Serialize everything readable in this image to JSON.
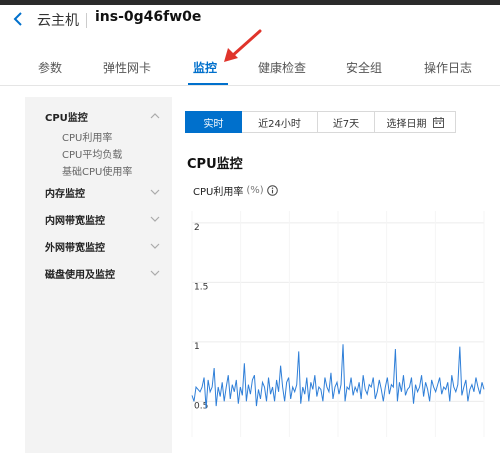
{
  "header": {
    "host_label": "云主机",
    "instance_id": "ins-0g46fw0e"
  },
  "tabs": [
    {
      "label": "参数",
      "active": false
    },
    {
      "label": "弹性网卡",
      "active": false
    },
    {
      "label": "监控",
      "active": true
    },
    {
      "label": "健康检查",
      "active": false
    },
    {
      "label": "安全组",
      "active": false
    },
    {
      "label": "操作日志",
      "active": false
    }
  ],
  "sidebar": {
    "groups": [
      {
        "label": "CPU监控",
        "expanded": true,
        "items": [
          "CPU利用率",
          "CPU平均负载",
          "基础CPU使用率"
        ]
      },
      {
        "label": "内存监控",
        "expanded": false
      },
      {
        "label": "内网带宽监控",
        "expanded": false
      },
      {
        "label": "外网带宽监控",
        "expanded": false
      },
      {
        "label": "磁盘使用及监控",
        "expanded": false
      }
    ]
  },
  "time_range": {
    "options": [
      "实时",
      "近24小时",
      "近7天",
      "选择日期"
    ],
    "selected": "实时"
  },
  "section_title": "CPU监控",
  "chart_title": "CPU利用率",
  "chart_unit": "(%)",
  "colors": {
    "accent": "#0070cc",
    "line": "#2f7fd8",
    "annotation_arrow": "#e0342b"
  },
  "chart_data": {
    "type": "line",
    "title": "CPU利用率",
    "ylabel": "(%)",
    "xlabel": "",
    "ylim": [
      0.2,
      2.1
    ],
    "y_ticks": [
      "2",
      "1.5",
      "1",
      "0.5"
    ],
    "grid": true,
    "series": [
      {
        "values": [
          0.55,
          0.5,
          0.62,
          0.6,
          0.58,
          0.62,
          0.7,
          0.44,
          0.68,
          0.58,
          0.62,
          0.78,
          0.46,
          0.62,
          0.54,
          0.66,
          0.5,
          0.62,
          0.72,
          0.52,
          0.64,
          0.58,
          0.68,
          0.48,
          0.62,
          0.55,
          0.82,
          0.5,
          0.64,
          0.56,
          0.68,
          0.72,
          0.46,
          0.6,
          0.52,
          0.66,
          0.62,
          0.5,
          0.7,
          0.56,
          0.62,
          0.5,
          0.68,
          0.58,
          0.8,
          0.62,
          0.5,
          0.66,
          0.7,
          0.52,
          0.62,
          0.58,
          0.64,
          0.92,
          0.48,
          0.62,
          0.56,
          0.7,
          0.5,
          0.66,
          0.6,
          0.72,
          0.54,
          0.62,
          0.6,
          0.5,
          0.7,
          0.62,
          0.58,
          0.74,
          0.52,
          0.62,
          0.66,
          0.56,
          0.64,
          0.98,
          0.5,
          0.62,
          0.6,
          0.7,
          0.55,
          0.62,
          0.58,
          0.66,
          0.52,
          0.72,
          0.6,
          0.56,
          0.64,
          0.62,
          0.7,
          0.52,
          0.58,
          0.68,
          0.6,
          0.5,
          0.62,
          0.7,
          0.56,
          0.64,
          0.62,
          0.94,
          0.5,
          0.66,
          0.58,
          0.72,
          0.55,
          0.6,
          0.62,
          0.7,
          0.48,
          0.64,
          0.58,
          0.62,
          0.72,
          0.54,
          0.66,
          0.6,
          0.5,
          0.68,
          0.62,
          0.58,
          0.64,
          0.7,
          0.56,
          0.62,
          0.6,
          0.66,
          0.5,
          0.72,
          0.62,
          0.58,
          0.64,
          0.96,
          0.55,
          0.62,
          0.68,
          0.5,
          0.6,
          0.64,
          0.58,
          0.7,
          0.62,
          0.56,
          0.66,
          0.6
        ]
      }
    ]
  }
}
